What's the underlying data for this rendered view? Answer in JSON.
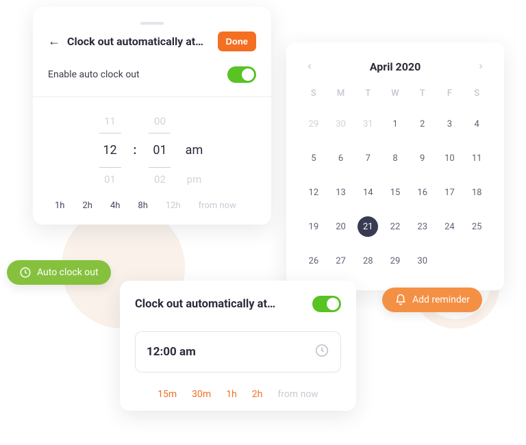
{
  "card1": {
    "title": "Clock out automatically at…",
    "done": "Done",
    "enable_label": "Enable auto clock out",
    "toggle_on": true,
    "picker": {
      "hour_prev": "11",
      "hour": "12",
      "hour_next": "01",
      "minute_prev": "00",
      "minute": "01",
      "minute_next": "02",
      "period": "am",
      "period_alt": "pm"
    },
    "quick": {
      "a": "1h",
      "b": "2h",
      "c": "4h",
      "d": "8h",
      "e": "12h",
      "suffix": "from now"
    }
  },
  "pill_green": "Auto clock out",
  "pill_orange": "Add reminder",
  "calendar": {
    "title": "April 2020",
    "dow": [
      "S",
      "M",
      "T",
      "W",
      "T",
      "F",
      "S"
    ],
    "days": [
      {
        "n": 29,
        "out": true
      },
      {
        "n": 30,
        "out": true
      },
      {
        "n": 31,
        "out": true
      },
      {
        "n": 1
      },
      {
        "n": 2
      },
      {
        "n": 3
      },
      {
        "n": 4
      },
      {
        "n": 5
      },
      {
        "n": 6
      },
      {
        "n": 7
      },
      {
        "n": 8
      },
      {
        "n": 9
      },
      {
        "n": 10
      },
      {
        "n": 11
      },
      {
        "n": 12
      },
      {
        "n": 13
      },
      {
        "n": 14
      },
      {
        "n": 15
      },
      {
        "n": 16
      },
      {
        "n": 17
      },
      {
        "n": 18
      },
      {
        "n": 19
      },
      {
        "n": 20
      },
      {
        "n": 21,
        "sel": true
      },
      {
        "n": 22
      },
      {
        "n": 23
      },
      {
        "n": 24
      },
      {
        "n": 25
      },
      {
        "n": 26
      },
      {
        "n": 27
      },
      {
        "n": 28
      },
      {
        "n": 29
      },
      {
        "n": 30
      }
    ]
  },
  "card3": {
    "title": "Clock out automatically at…",
    "toggle_on": true,
    "time": "12:00 am",
    "quick": {
      "a": "15m",
      "b": "30m",
      "c": "1h",
      "d": "2h",
      "suffix": "from now"
    }
  }
}
